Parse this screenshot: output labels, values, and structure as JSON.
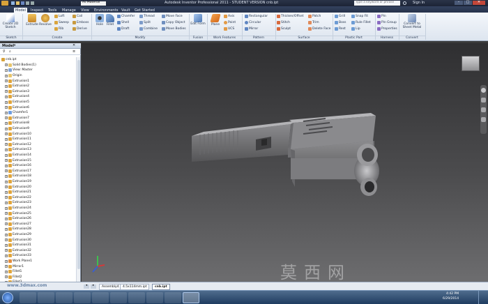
{
  "title": {
    "text": "Autodesk Inventor Professional 2011 - STUDENT VERSION    cnb.ipt",
    "material": "As Material",
    "search_placeholder": "Type a keyword or phrase",
    "sign_in": "Sign In"
  },
  "tabs": [
    "Model",
    "Inspect",
    "Tools",
    "Manage",
    "View",
    "Environments",
    "Vault",
    "Get Started"
  ],
  "ribbon": {
    "sketch": {
      "create_2d": "Create 2D Sketch",
      "group": "Sketch"
    },
    "create": {
      "extrude": "Extrude",
      "revolve": "Revolve",
      "loft": "Loft",
      "sweep": "Sweep",
      "rib": "Rib",
      "coil": "Coil",
      "emboss": "Emboss",
      "derive": "Derive",
      "group": "Create"
    },
    "modify": {
      "hole": "Hole",
      "fillet": "Fillet",
      "chamfer": "Chamfer",
      "shell": "Shell",
      "draft": "Draft",
      "thread": "Thread",
      "split": "Split",
      "combine": "Combine",
      "move_face": "Move Face",
      "copy_object": "Copy Object",
      "move_bodies": "Move Bodies",
      "group": "Modify"
    },
    "fusion": {
      "edit_form": "Edit Form",
      "group": "Fusion"
    },
    "work": {
      "plane": "Plane",
      "axis": "Axis",
      "point": "Point",
      "ucs": "UCS",
      "group": "Work Features"
    },
    "pattern": {
      "rectangular": "Rectangular",
      "circular": "Circular",
      "mirror": "Mirror",
      "group": "Pattern"
    },
    "surface": {
      "thicken": "Thicken/Offset",
      "stitch": "Stitch",
      "sculpt": "Sculpt",
      "patch": "Patch",
      "trim": "Trim",
      "delete_face": "Delete Face",
      "group": "Surface"
    },
    "plastic": {
      "grill": "Grill",
      "boss": "Boss",
      "rest": "Rest",
      "snap_fit": "Snap Fit",
      "rule_fillet": "Rule Fillet",
      "lip": "Lip",
      "group": "Plastic Part"
    },
    "harness": {
      "pin": "Pin",
      "pin_group": "Pin Group",
      "properties": "Properties",
      "group": "Harness"
    },
    "convert": {
      "sheet_metal": "Convert to Sheet Metal",
      "group": "Convert"
    }
  },
  "browser": {
    "header": "Model",
    "items": [
      {
        "label": "cnb.ipt",
        "indent": 0,
        "icon": "part"
      },
      {
        "label": "Solid Bodies(1)",
        "indent": 1,
        "icon": "folder"
      },
      {
        "label": "View: Master",
        "indent": 1,
        "icon": "view"
      },
      {
        "label": "Origin",
        "indent": 1,
        "icon": "folder"
      },
      {
        "label": "Extrusion1",
        "indent": 1,
        "icon": "feature"
      },
      {
        "label": "Extrusion2",
        "indent": 1,
        "icon": "feature"
      },
      {
        "label": "Extrusion3",
        "indent": 1,
        "icon": "feature"
      },
      {
        "label": "Extrusion4",
        "indent": 1,
        "icon": "feature"
      },
      {
        "label": "Extrusion5",
        "indent": 1,
        "icon": "feature"
      },
      {
        "label": "Extrusion6",
        "indent": 1,
        "icon": "feature"
      },
      {
        "label": "Chamfer1",
        "indent": 1,
        "icon": "chamfer"
      },
      {
        "label": "Extrusion7",
        "indent": 1,
        "icon": "feature"
      },
      {
        "label": "Extrusion8",
        "indent": 1,
        "icon": "feature"
      },
      {
        "label": "Extrusion9",
        "indent": 1,
        "icon": "feature"
      },
      {
        "label": "Extrusion10",
        "indent": 1,
        "icon": "feature"
      },
      {
        "label": "Extrusion11",
        "indent": 1,
        "icon": "feature"
      },
      {
        "label": "Extrusion12",
        "indent": 1,
        "icon": "feature"
      },
      {
        "label": "Extrusion13",
        "indent": 1,
        "icon": "feature"
      },
      {
        "label": "Extrusion14",
        "indent": 1,
        "icon": "feature"
      },
      {
        "label": "Extrusion15",
        "indent": 1,
        "icon": "feature"
      },
      {
        "label": "Extrusion16",
        "indent": 1,
        "icon": "feature"
      },
      {
        "label": "Extrusion17",
        "indent": 1,
        "icon": "feature"
      },
      {
        "label": "Extrusion18",
        "indent": 1,
        "icon": "feature"
      },
      {
        "label": "Extrusion19",
        "indent": 1,
        "icon": "feature"
      },
      {
        "label": "Extrusion20",
        "indent": 1,
        "icon": "feature"
      },
      {
        "label": "Extrusion21",
        "indent": 1,
        "icon": "feature"
      },
      {
        "label": "Extrusion22",
        "indent": 1,
        "icon": "feature"
      },
      {
        "label": "Extrusion23",
        "indent": 1,
        "icon": "feature"
      },
      {
        "label": "Extrusion24",
        "indent": 1,
        "icon": "feature"
      },
      {
        "label": "Extrusion25",
        "indent": 1,
        "icon": "feature"
      },
      {
        "label": "Extrusion26",
        "indent": 1,
        "icon": "feature"
      },
      {
        "label": "Extrusion27",
        "indent": 1,
        "icon": "feature"
      },
      {
        "label": "Extrusion28",
        "indent": 1,
        "icon": "feature"
      },
      {
        "label": "Extrusion29",
        "indent": 1,
        "icon": "feature"
      },
      {
        "label": "Extrusion30",
        "indent": 1,
        "icon": "feature"
      },
      {
        "label": "Extrusion31",
        "indent": 1,
        "icon": "feature"
      },
      {
        "label": "Extrusion32",
        "indent": 1,
        "icon": "feature"
      },
      {
        "label": "Extrusion33",
        "indent": 1,
        "icon": "feature"
      },
      {
        "label": "Work Plane1",
        "indent": 1,
        "icon": "plane"
      },
      {
        "label": "Mirror1",
        "indent": 1,
        "icon": "feature"
      },
      {
        "label": "Fillet1",
        "indent": 1,
        "icon": "feature"
      },
      {
        "label": "Fillet2",
        "indent": 1,
        "icon": "feature"
      },
      {
        "label": "Fillet3",
        "indent": 1,
        "icon": "feature"
      }
    ]
  },
  "doc_tabs": [
    "Assembly4",
    "4.5x114mm.ipt",
    "cnb.ipt"
  ],
  "tray": {
    "time": "4:42 PM",
    "date": "6/29/2014"
  },
  "watermark": {
    "url": "www.3dmax.com"
  },
  "colors": {
    "accent": "#2b4a78",
    "ribbon": "#e9eef5"
  }
}
